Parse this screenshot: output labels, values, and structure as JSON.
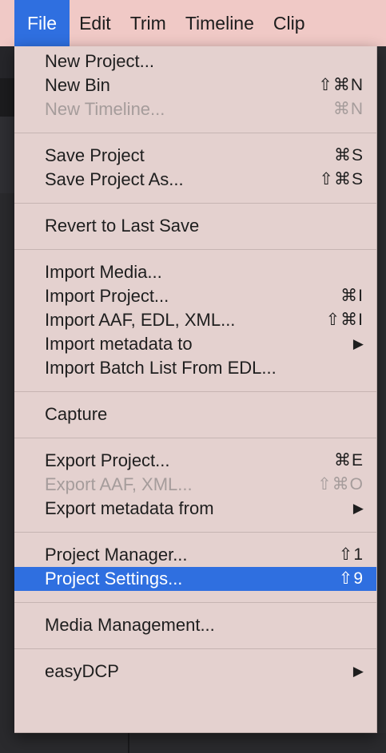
{
  "menubar": {
    "items": [
      {
        "label": "File",
        "active": true
      },
      {
        "label": "Edit"
      },
      {
        "label": "Trim"
      },
      {
        "label": "Timeline"
      },
      {
        "label": "Clip"
      }
    ]
  },
  "menu": {
    "groups": [
      [
        {
          "label": "New Project...",
          "shortcut": ""
        },
        {
          "label": "New Bin",
          "shortcut": "⇧⌘N"
        },
        {
          "label": "New Timeline...",
          "shortcut": "⌘N",
          "disabled": true
        }
      ],
      [
        {
          "label": "Save Project",
          "shortcut": "⌘S"
        },
        {
          "label": "Save Project As...",
          "shortcut": "⇧⌘S"
        }
      ],
      [
        {
          "label": "Revert to Last Save",
          "shortcut": ""
        }
      ],
      [
        {
          "label": "Import Media...",
          "shortcut": ""
        },
        {
          "label": "Import Project...",
          "shortcut": "⌘I"
        },
        {
          "label": "Import AAF, EDL, XML...",
          "shortcut": "⇧⌘I"
        },
        {
          "label": "Import metadata to",
          "submenu": true
        },
        {
          "label": "Import Batch List From EDL...",
          "shortcut": ""
        }
      ],
      [
        {
          "label": "Capture",
          "shortcut": ""
        }
      ],
      [
        {
          "label": "Export Project...",
          "shortcut": "⌘E"
        },
        {
          "label": "Export AAF, XML...",
          "shortcut": "⇧⌘O",
          "disabled": true
        },
        {
          "label": "Export metadata from",
          "submenu": true
        }
      ],
      [
        {
          "label": "Project Manager...",
          "shortcut": "⇧1"
        },
        {
          "label": "Project Settings...",
          "shortcut": "⇧9",
          "highlighted": true
        }
      ],
      [
        {
          "label": "Media Management...",
          "shortcut": ""
        }
      ],
      [
        {
          "label": "easyDCP",
          "submenu": true
        }
      ]
    ],
    "submenu_arrow": "▶"
  },
  "colors": {
    "menubar_bg": "#f0c9c6",
    "menu_bg": "#e4d1cf",
    "highlight": "#2f6fe0",
    "disabled_text": "#a59c9b"
  }
}
